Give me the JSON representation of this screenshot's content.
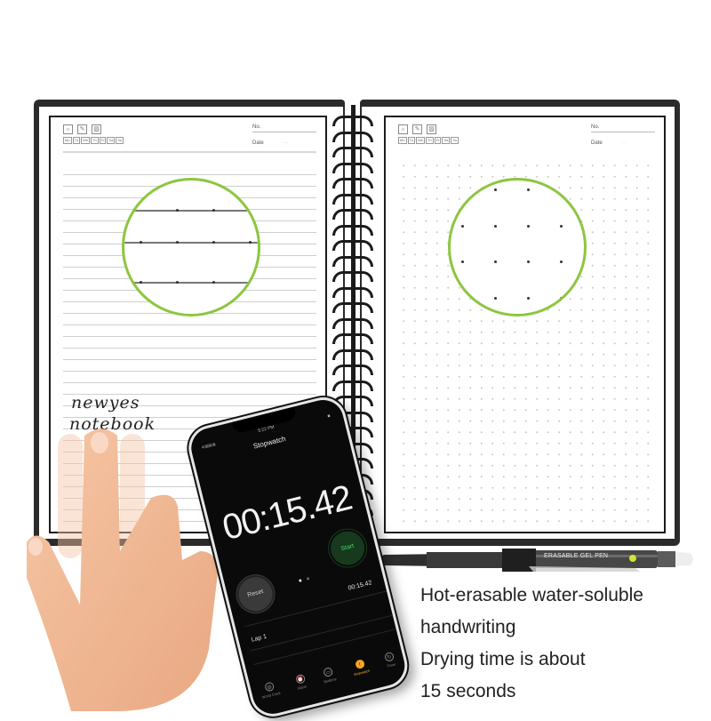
{
  "notebook": {
    "left_page": {
      "header_icons": [
        "sun-icon",
        "pencil-icon",
        "image-icon"
      ],
      "weekdays": [
        "Mo",
        "Tu",
        "We",
        "Th",
        "Fr",
        "Sa",
        "Su"
      ],
      "no_label": "No.",
      "date_label": "Date",
      "date_separators": "·   ·",
      "style": "lined"
    },
    "right_page": {
      "header_icons": [
        "sun-icon",
        "pencil-icon",
        "image-icon"
      ],
      "weekdays": [
        "Mo",
        "Tu",
        "We",
        "Th",
        "Fr",
        "Sa",
        "Su"
      ],
      "no_label": "No.",
      "date_label": "Date",
      "date_separators": "·   ·",
      "style": "dotted"
    },
    "handwriting": {
      "line1": "newyes",
      "line2": "notebook"
    },
    "highlight_color": "#8cc63f"
  },
  "phone": {
    "status_time": "5:22 PM",
    "status_carrier": "中国联通",
    "status_battery": "■",
    "app_title": "Stopwatch",
    "timer_display": "00:15.42",
    "reset_label": "Reset",
    "start_label": "Start",
    "current_lap_time": "00:15.42",
    "laps": [
      {
        "label": "Lap 1"
      }
    ],
    "tabs": [
      {
        "label": "World Clock",
        "icon": "globe-icon",
        "glyph": "◍",
        "active": false
      },
      {
        "label": "Alarm",
        "icon": "alarm-icon",
        "glyph": "⏰",
        "active": false
      },
      {
        "label": "Bedtime",
        "icon": "bed-icon",
        "glyph": "▭",
        "active": false
      },
      {
        "label": "Stopwatch",
        "icon": "stopwatch-icon",
        "glyph": "!",
        "active": true
      },
      {
        "label": "Timer",
        "icon": "timer-icon",
        "glyph": "↻",
        "active": false
      }
    ]
  },
  "pen": {
    "label": "ERASABLE GEL PEN",
    "badge": "☺"
  },
  "caption": {
    "line1": "Hot-erasable water-soluble",
    "line2": "handwriting",
    "line3": "Drying time is about",
    "line4": "15 seconds"
  }
}
